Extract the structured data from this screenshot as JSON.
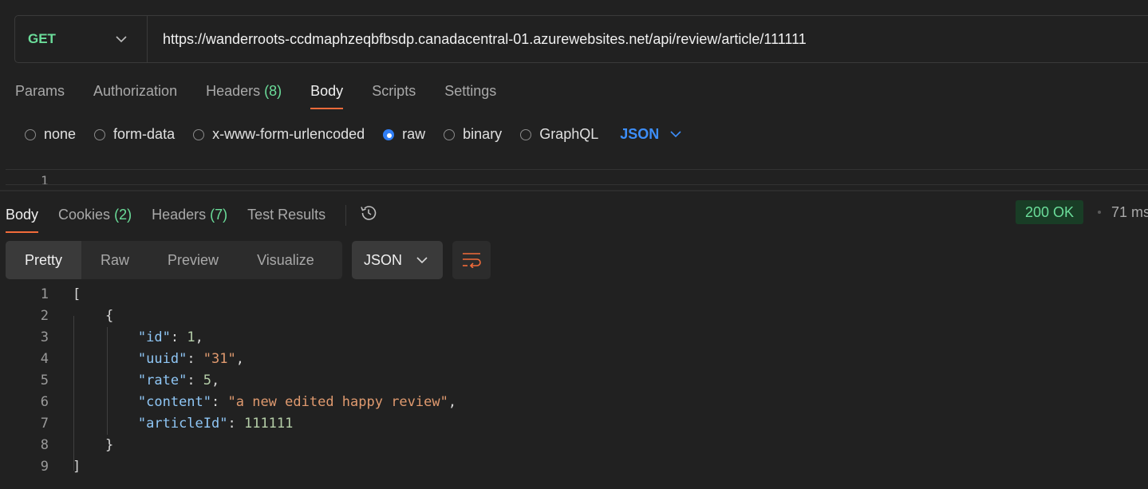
{
  "request": {
    "method": "GET",
    "url": "https://wanderroots-ccdmaphzeqbfbsdp.canadacentral-01.azurewebsites.net/api/review/article/111111"
  },
  "request_tabs": [
    {
      "label": "Params",
      "count": ""
    },
    {
      "label": "Authorization",
      "count": ""
    },
    {
      "label": "Headers",
      "count": "(8)"
    },
    {
      "label": "Body",
      "count": ""
    },
    {
      "label": "Scripts",
      "count": ""
    },
    {
      "label": "Settings",
      "count": ""
    }
  ],
  "active_request_tab": "Body",
  "body_types": [
    "none",
    "form-data",
    "x-www-form-urlencoded",
    "raw",
    "binary",
    "GraphQL"
  ],
  "selected_body_type": "raw",
  "body_language": "JSON",
  "request_editor": {
    "line_number": "1"
  },
  "response_tabs": [
    {
      "label": "Body",
      "count": ""
    },
    {
      "label": "Cookies",
      "count": "(2)"
    },
    {
      "label": "Headers",
      "count": "(7)"
    },
    {
      "label": "Test Results",
      "count": ""
    }
  ],
  "active_response_tab": "Body",
  "status": {
    "code": "200 OK",
    "time": "71 ms"
  },
  "view_modes": [
    "Pretty",
    "Raw",
    "Preview",
    "Visualize"
  ],
  "active_view_mode": "Pretty",
  "response_format": "JSON",
  "response_lines": [
    {
      "num": "1",
      "text": "["
    },
    {
      "num": "2",
      "text": "{"
    },
    {
      "num": "3",
      "key": "\"id\"",
      "value": "1",
      "type": "number",
      "comma": ","
    },
    {
      "num": "4",
      "key": "\"uuid\"",
      "value": "\"31\"",
      "type": "string",
      "comma": ","
    },
    {
      "num": "5",
      "key": "\"rate\"",
      "value": "5",
      "type": "number",
      "comma": ","
    },
    {
      "num": "6",
      "key": "\"content\"",
      "value": "\"a new edited happy review\"",
      "type": "string",
      "comma": ","
    },
    {
      "num": "7",
      "key": "\"articleId\"",
      "value": "111111",
      "type": "number",
      "comma": ""
    },
    {
      "num": "8",
      "text": "}"
    },
    {
      "num": "9",
      "text": "]"
    }
  ],
  "colors": {
    "accent": "#f26b3a",
    "method_get": "#6bdd9a",
    "radio_selected": "#2f7ef6",
    "json_selector": "#3d8ef8",
    "json_key": "#8fc6f5",
    "json_string": "#e09a6f",
    "json_number": "#b5cea8"
  }
}
